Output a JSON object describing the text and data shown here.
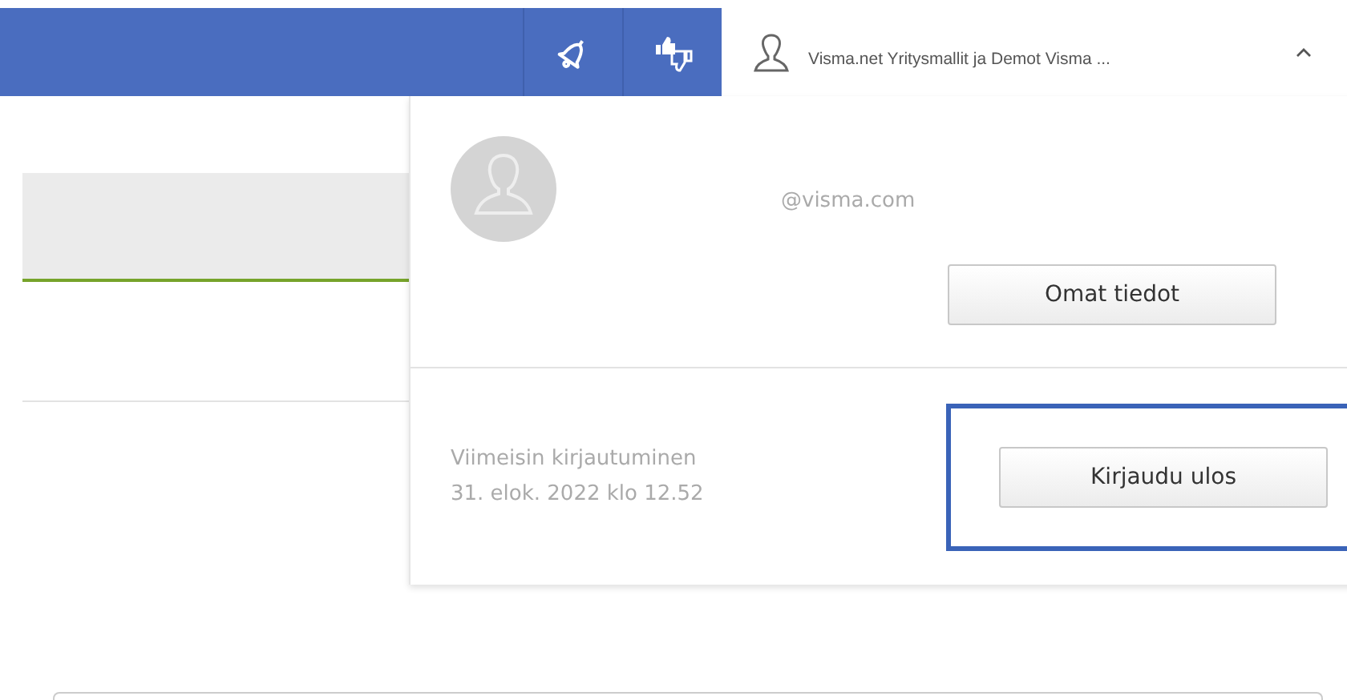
{
  "header": {
    "user_name": "Visma.net Yritysmallit ja Demot Visma ...",
    "menu_expanded": true
  },
  "user_menu": {
    "email": "@visma.com",
    "profile_button": "Omat tiedot",
    "last_login_label": "Viimeisin kirjautuminen",
    "last_login_time": "31. elok. 2022 klo 12.52",
    "logout_button": {
      "label": "Kirjaudu ulos",
      "highlighted": true
    }
  }
}
